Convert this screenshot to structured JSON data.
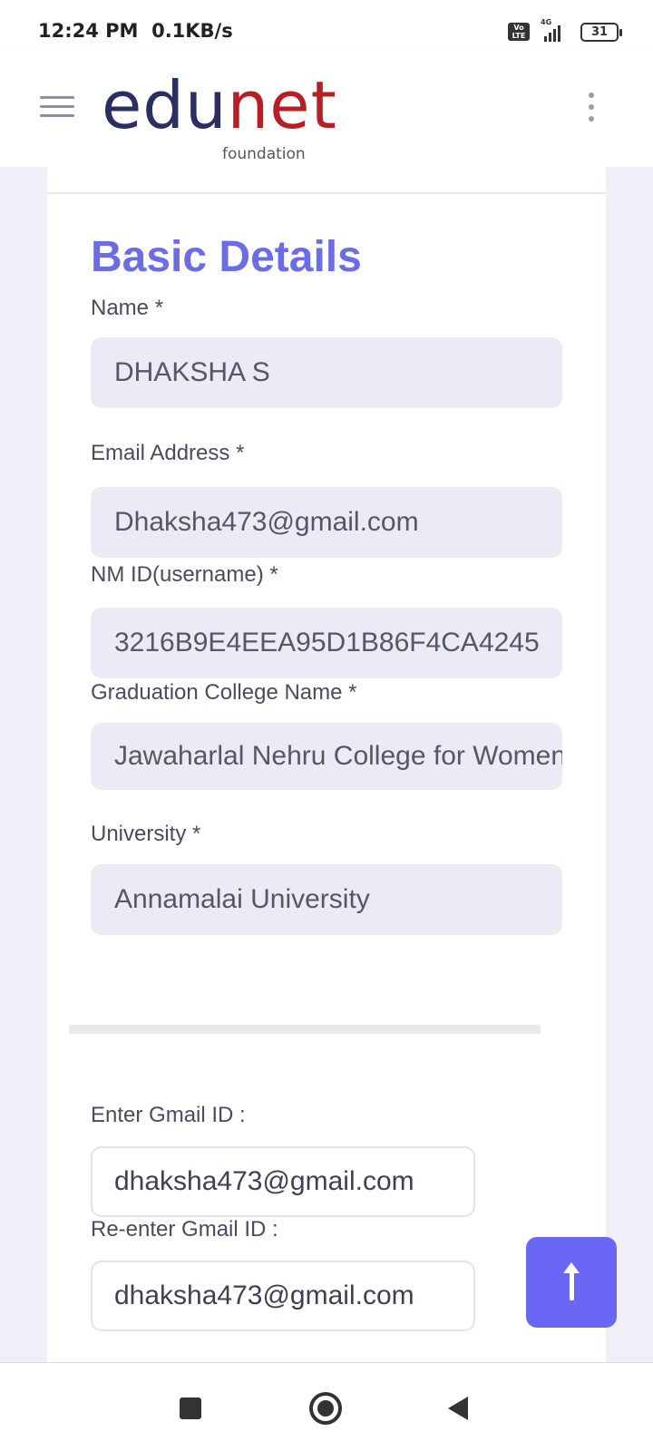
{
  "status_bar": {
    "time": "12:24 PM",
    "speed": "0.1KB/s",
    "volte_label": "Vo LTE",
    "network_label": "4G",
    "battery": "31"
  },
  "header": {
    "logo_primary_a": "edu",
    "logo_primary_b": "net",
    "logo_secondary": "foundation",
    "brand_colors": {
      "edu": "#2b2e62",
      "net": "#b81f24"
    }
  },
  "form": {
    "title": "Basic Details",
    "fields": [
      {
        "label": "Name *",
        "value": "DHAKSHA S"
      },
      {
        "label": "Email Address *",
        "value": "Dhaksha473@gmail.com"
      },
      {
        "label": "NM ID(username) *",
        "value": "3216B9E4EEA95D1B86F4CA4245"
      },
      {
        "label": "Graduation College Name *",
        "value": "Jawaharlal Nehru College for Women"
      },
      {
        "label": "University *",
        "value": "Annamalai University"
      }
    ],
    "gmail": {
      "label": "Enter Gmail ID :",
      "value": "dhaksha473@gmail.com"
    },
    "gmail_confirm": {
      "label": "Re-enter Gmail ID :",
      "value": "dhaksha473@gmail.com"
    }
  },
  "accent_color": "#6b67f5",
  "icons": {
    "menu": "hamburger-icon",
    "more": "kebab-icon",
    "scroll_top": "arrow-up-icon",
    "nav": [
      "recents-icon",
      "home-icon",
      "back-icon"
    ]
  }
}
